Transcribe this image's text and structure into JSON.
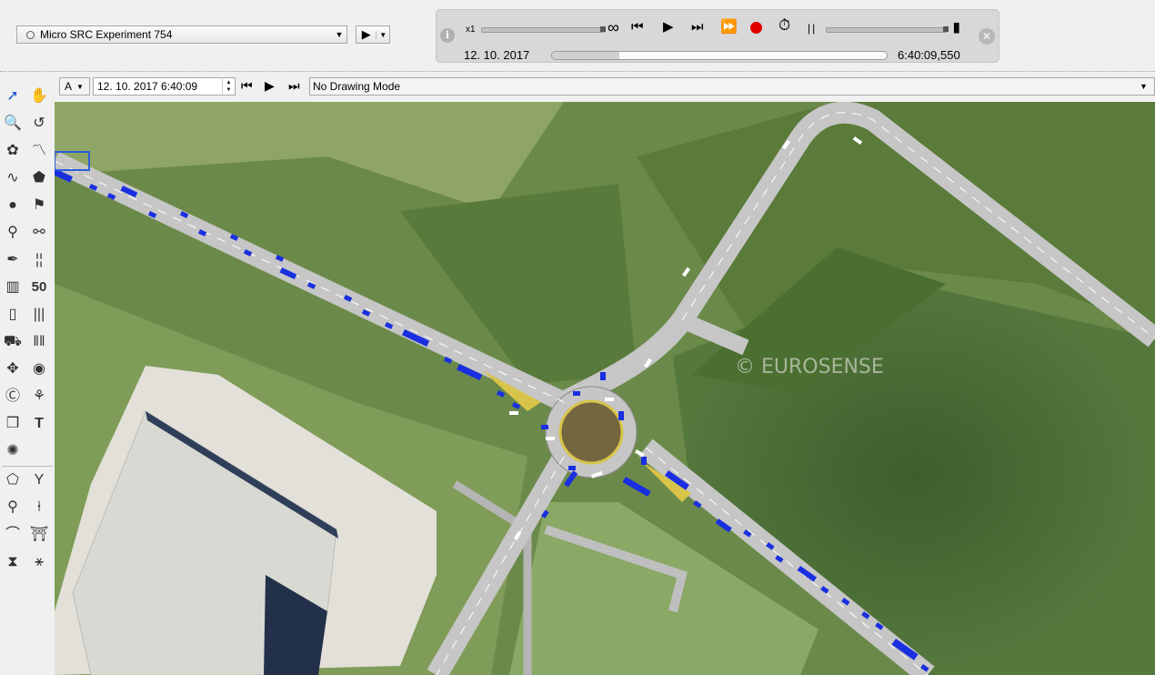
{
  "experiment": {
    "name": "Micro SRC Experiment 754"
  },
  "player": {
    "speed": "x1",
    "infinity": "∞",
    "date": "12. 10. 2017",
    "time": "6:40:09,550",
    "timeline_fraction": 0.2
  },
  "toolbar": {
    "layer_button": "A",
    "datetime_value": "12. 10. 2017 6:40:09",
    "drawing_mode": "No Drawing Mode"
  },
  "map": {
    "watermark": "© EUROSENSE"
  },
  "icons": {
    "info": "info-icon",
    "close": "close-icon",
    "record": "record-icon",
    "timer": "timer-icon"
  },
  "colors": {
    "vehicle": "#1a2fe0",
    "record": "#e00000",
    "road": "#c8c8c8"
  }
}
